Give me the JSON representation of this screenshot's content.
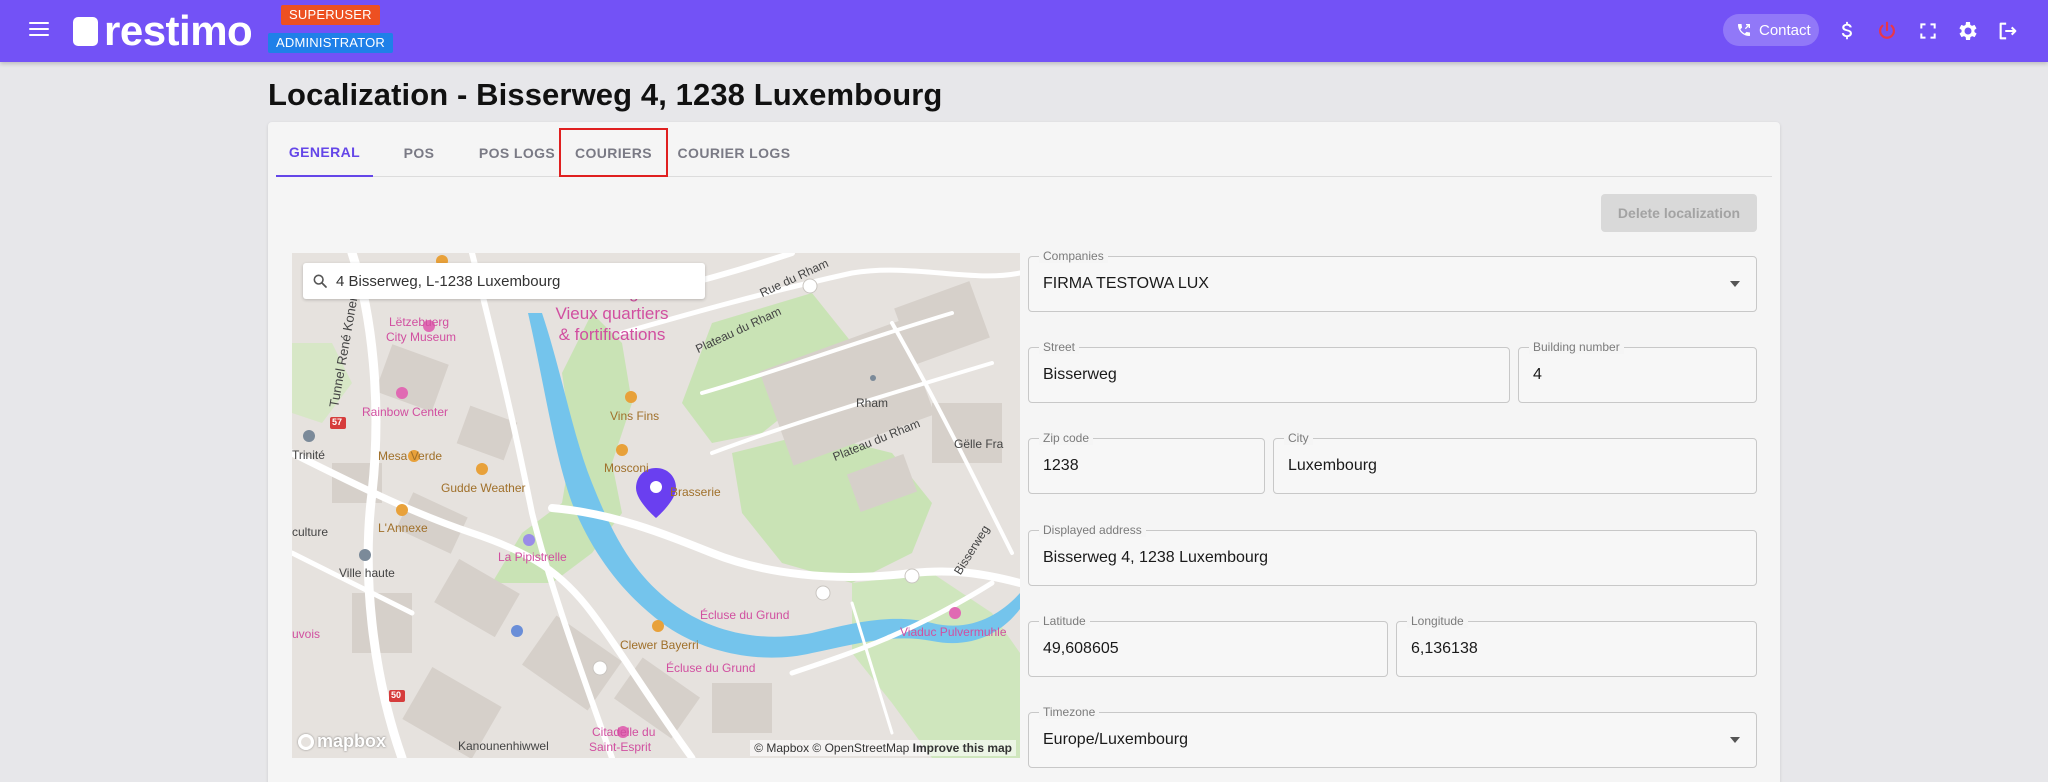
{
  "app": {
    "logo_text": "restimo",
    "badge_superuser": "SUPERUSER",
    "badge_admin": "ADMINISTRATOR",
    "contact_label": "Contact"
  },
  "page": {
    "title": "Localization - Bisserweg 4, 1238 Luxembourg"
  },
  "tabs": [
    {
      "label": "GENERAL"
    },
    {
      "label": "POS"
    },
    {
      "label": "POS LOGS"
    },
    {
      "label": "COURIERS"
    },
    {
      "label": "COURIER LOGS"
    }
  ],
  "actions": {
    "delete_label": "Delete localization"
  },
  "map": {
    "search_value": "4 Bisserweg, L-1238 Luxembourg",
    "attribution": "© Mapbox © OpenStreetMap",
    "improve": "Improve this map",
    "logo": "mapbox",
    "labels": {
      "rue_du_rham": "Rue du Rham",
      "tunnel": "Tunnel René Konen",
      "lezebuerg": "Lëtzebuerg",
      "city_museum": "City Museum",
      "lux_ville": "Luxembourg Ville:",
      "vieux": "Vieux quartiers",
      "fortif": "& fortifications",
      "plateau1": "Plateau du Rham",
      "rham": "Rham",
      "plateau2": "Plateau du Rham",
      "gelle_fra": "Gëlle Fra",
      "rainbow": "Rainbow Center",
      "vins_fins": "Vins Fins",
      "trinite": "Trinité",
      "mesa": "Mesa Verde",
      "mosconi": "Mosconi",
      "bistro": "Brasserie",
      "gudde": "Gudde Weather",
      "culture": "culture",
      "lannexe": "L'Annexe",
      "pipistrelle": "La Pipistrelle",
      "ville_haute": "Ville haute",
      "ecluse1": "Écluse du Grund",
      "bisserweg": "Bisserweg",
      "viaduc": "Viaduc Pulvermuhle",
      "uvois": "uvois",
      "clewer": "Clewer Bayerri",
      "ecluse2": "Écluse du Grund",
      "citadelle": "Citadelle du",
      "saint_esprit": "Saint-Esprit",
      "kanounen": "Kanounenhiwwel",
      "r57": "57",
      "r50": "50"
    }
  },
  "form": {
    "companies": {
      "label": "Companies",
      "value": "FIRMA TESTOWA LUX"
    },
    "street": {
      "label": "Street",
      "value": "Bisserweg"
    },
    "building": {
      "label": "Building number",
      "value": "4"
    },
    "zip": {
      "label": "Zip code",
      "value": "1238"
    },
    "city": {
      "label": "City",
      "value": "Luxembourg"
    },
    "displayed": {
      "label": "Displayed address",
      "value": "Bisserweg 4, 1238 Luxembourg"
    },
    "latitude": {
      "label": "Latitude",
      "value": "49,608605"
    },
    "longitude": {
      "label": "Longitude",
      "value": "6,136138"
    },
    "timezone": {
      "label": "Timezone",
      "value": "Europe/Luxembourg"
    }
  },
  "colors": {
    "topbar": "#7352f6",
    "accent": "#6446e8",
    "superuser": "#ed5021",
    "admin": "#1f80e8",
    "highlight": "#e02020"
  }
}
